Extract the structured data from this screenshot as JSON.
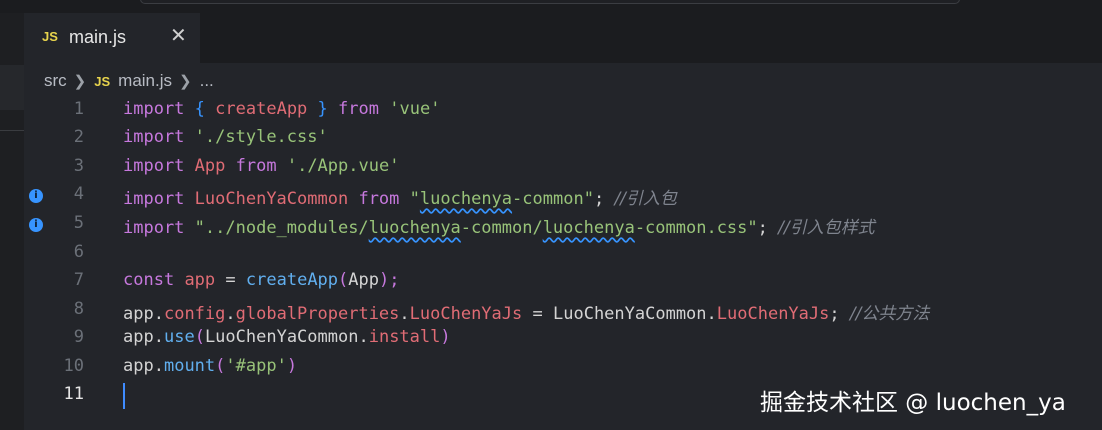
{
  "tab": {
    "icon": "JS",
    "title": "main.js",
    "close": "✕"
  },
  "breadcrumb": {
    "folder": "src",
    "file_icon": "JS",
    "file": "main.js",
    "more": "..."
  },
  "lines": [
    {
      "num": "1"
    },
    {
      "num": "2"
    },
    {
      "num": "3"
    },
    {
      "num": "4"
    },
    {
      "num": "5"
    },
    {
      "num": "6"
    },
    {
      "num": "7"
    },
    {
      "num": "8"
    },
    {
      "num": "9"
    },
    {
      "num": "10"
    },
    {
      "num": "11"
    }
  ],
  "code": {
    "l1": {
      "import": "import",
      "open": "{",
      "name": "createApp",
      "close": "}",
      "from": "from",
      "src": "'vue'"
    },
    "l2": {
      "import": "import",
      "src": "'./style.css'"
    },
    "l3": {
      "import": "import",
      "name": "App",
      "from": "from",
      "src": "'./App.vue'"
    },
    "l4": {
      "import": "import",
      "name": "LuoChenYaCommon",
      "from": "from",
      "q1": "\"",
      "p1": "luochenya",
      "p2": "-common",
      "q2": "\"",
      "semi": ";",
      "comment": "//引入包"
    },
    "l5": {
      "import": "import",
      "s1": "\"../node_modules/",
      "p1": "luochenya",
      "s2": "-common/",
      "p2": "luochenya",
      "s3": "-common.css\"",
      "semi": ";",
      "comment": "//引入包样式"
    },
    "l7": {
      "const": "const",
      "var": "app",
      "eq": "=",
      "fn": "createApp",
      "open": "(",
      "arg": "App",
      "close": ");"
    },
    "l8": {
      "obj": "app",
      "d1": ".",
      "p1": "config",
      "d2": ".",
      "p2": "globalProperties",
      "d3": ".",
      "p3": "LuoChenYaJs",
      "eq": "=",
      "rhs": "LuoChenYaCommon",
      "d4": ".",
      "p4": "LuoChenYaJs",
      "semi": ";",
      "comment": "//公共方法"
    },
    "l9": {
      "obj": "app",
      "d1": ".",
      "fn": "use",
      "open": "(",
      "arg": "LuoChenYaCommon",
      "d2": ".",
      "p": "install",
      "close": ")"
    },
    "l10": {
      "obj": "app",
      "d1": ".",
      "fn": "mount",
      "open": "(",
      "arg": "'#app'",
      "close": ")"
    }
  },
  "gutter_markers": [
    {
      "line": "4",
      "icon": "info-icon",
      "glyph": "i"
    },
    {
      "line": "5",
      "icon": "info-icon",
      "glyph": "i"
    }
  ],
  "watermark": "掘金技术社区 @ luochen_ya",
  "colors": {
    "keyword": "#c678dd",
    "string": "#98c379",
    "function": "#61afef",
    "property": "#e06c75",
    "comment": "#7f848e",
    "accent": "#3794ff"
  }
}
